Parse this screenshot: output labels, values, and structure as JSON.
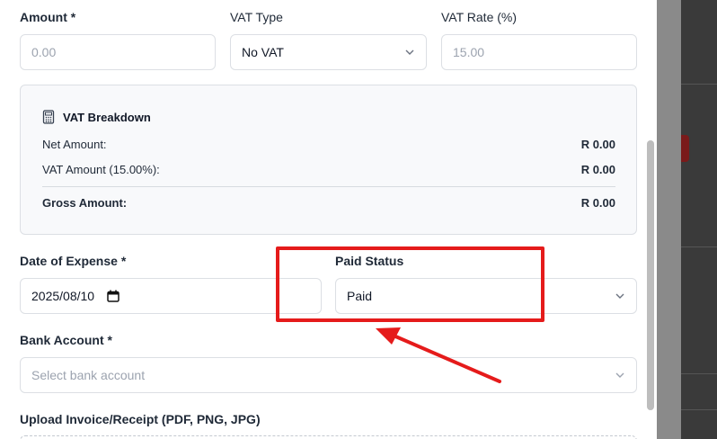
{
  "amount": {
    "label": "Amount *",
    "placeholder": "0.00"
  },
  "vat_type": {
    "label": "VAT Type",
    "value": "No VAT"
  },
  "vat_rate": {
    "label": "VAT Rate (%)",
    "placeholder": "15.00"
  },
  "vat_breakdown": {
    "title": "VAT Breakdown",
    "icon": "calculator-icon",
    "rows": [
      {
        "label": "Net Amount:",
        "value": "R 0.00"
      },
      {
        "label": "VAT Amount (15.00%):",
        "value": "R 0.00"
      }
    ],
    "gross": {
      "label": "Gross Amount:",
      "value": "R 0.00"
    }
  },
  "date_of_expense": {
    "label": "Date of Expense *",
    "value": "2025/08/10"
  },
  "paid_status": {
    "label": "Paid Status",
    "value": "Paid"
  },
  "bank_account": {
    "label": "Bank Account *",
    "placeholder": "Select bank account"
  },
  "upload": {
    "label": "Upload Invoice/Receipt (PDF, PNG, JPG)"
  },
  "colors": {
    "annotation": "#e51b1b",
    "border": "#dcdfe4",
    "panel_bg": "#f8f9fb"
  }
}
